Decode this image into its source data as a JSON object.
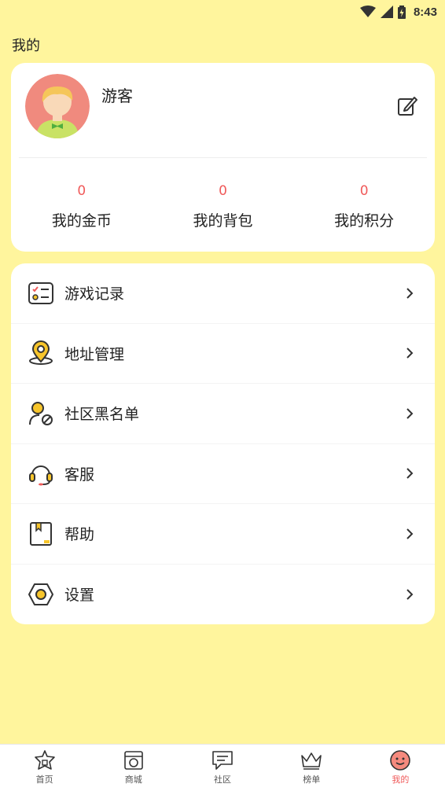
{
  "status_bar": {
    "time": "8:43"
  },
  "page_title": "我的",
  "profile": {
    "username": "游客",
    "stats": [
      {
        "value": "0",
        "label": "我的金币"
      },
      {
        "value": "0",
        "label": "我的背包"
      },
      {
        "value": "0",
        "label": "我的积分"
      }
    ]
  },
  "menu": [
    {
      "label": "游戏记录",
      "icon": "game-record-icon"
    },
    {
      "label": "地址管理",
      "icon": "location-icon"
    },
    {
      "label": "社区黑名单",
      "icon": "blocked-user-icon"
    },
    {
      "label": "客服",
      "icon": "headset-icon"
    },
    {
      "label": "帮助",
      "icon": "help-book-icon"
    },
    {
      "label": "设置",
      "icon": "settings-hexagon-icon"
    }
  ],
  "nav": [
    {
      "label": "首页",
      "icon": "home-icon"
    },
    {
      "label": "商城",
      "icon": "shop-icon"
    },
    {
      "label": "社区",
      "icon": "community-chat-icon"
    },
    {
      "label": "榜单",
      "icon": "crown-icon"
    },
    {
      "label": "我的",
      "icon": "profile-face-icon",
      "active": true
    }
  ],
  "colors": {
    "background": "#FFF59D",
    "accent_red": "#F05A5A",
    "icon_yellow": "#F7C52B",
    "icon_stroke": "#333333"
  }
}
